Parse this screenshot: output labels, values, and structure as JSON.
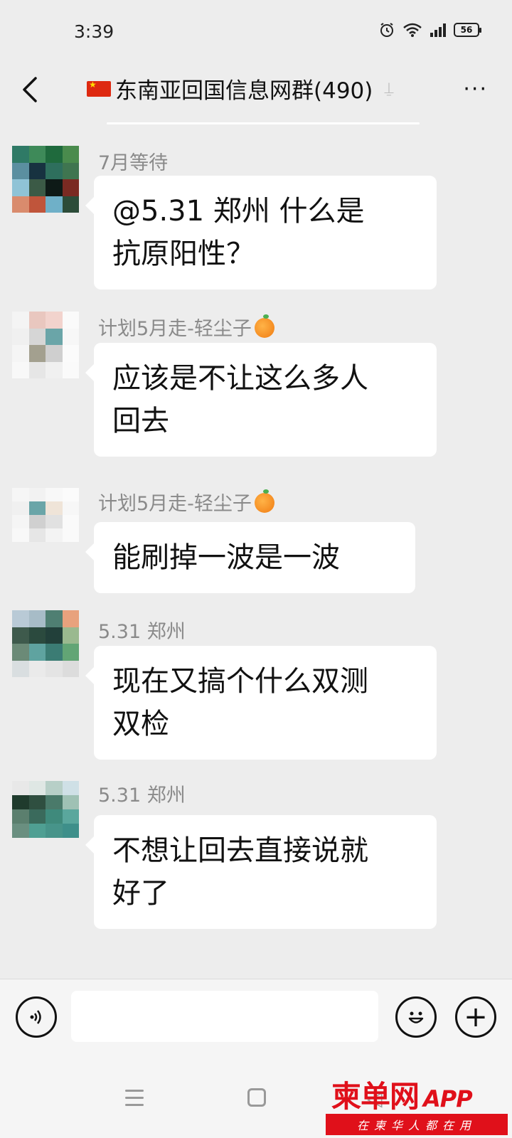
{
  "status_bar": {
    "time": "3:39",
    "battery": "56"
  },
  "header": {
    "title": "东南亚回国信息网群(490)",
    "more": "···"
  },
  "messages": [
    {
      "sender": "7月等待",
      "text_lines": [
        "@5.31  郑州  什么是",
        "抗原阳性？"
      ]
    },
    {
      "sender": "计划5月走-轻尘子",
      "text_lines": [
        "应该是不让这么多人",
        "回去"
      ]
    },
    {
      "sender": "计划5月走-轻尘子",
      "text_lines": [
        "能刷掉一波是一波"
      ]
    },
    {
      "sender": "5.31  郑州",
      "text_lines": [
        "现在又搞个什么双测",
        "双检"
      ]
    },
    {
      "sender": "5.31  郑州",
      "text_lines": [
        "不想让回去直接说就",
        "好了"
      ]
    }
  ],
  "input_bar": {
    "plus": "+"
  },
  "watermark": {
    "main": "柬单网",
    "app": "APP",
    "sub": "在柬华人都在用"
  },
  "colors": {
    "background": "#ededed",
    "bubble": "#ffffff",
    "sender": "#8a8a8a",
    "watermark_red": "#e0101a"
  },
  "icons": [
    "back-arrow-icon",
    "flag-icon",
    "wifi-icon",
    "signal-icon",
    "alarm-icon",
    "voice-icon",
    "emoji-icon",
    "plus-icon",
    "orange-icon"
  ]
}
